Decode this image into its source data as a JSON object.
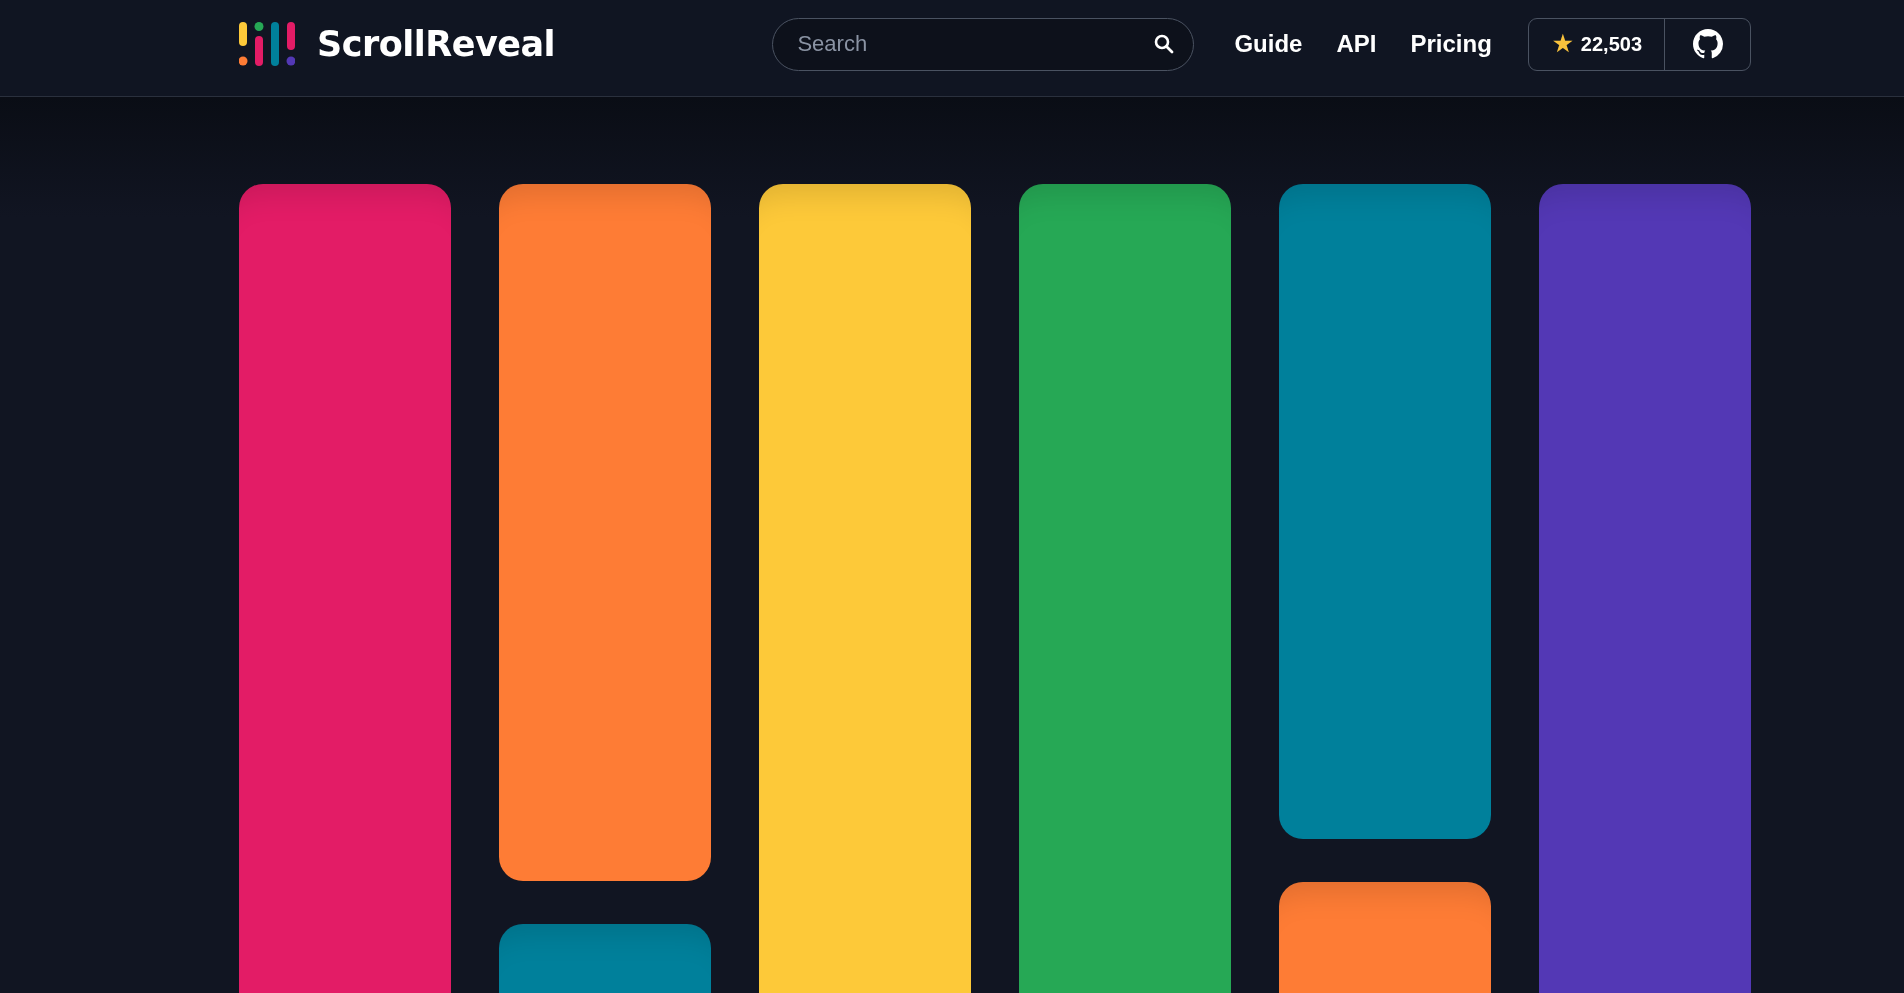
{
  "header": {
    "logo": "ScrollReveal",
    "search": {
      "placeholder": "Search"
    },
    "nav": [
      {
        "label": "Guide"
      },
      {
        "label": "API"
      },
      {
        "label": "Pricing"
      }
    ],
    "stars": {
      "icon": "★",
      "count": "22,503"
    }
  },
  "columns": [
    {
      "tiles": [
        {
          "kind": "fill",
          "color": "#e31c66"
        }
      ]
    },
    {
      "tiles": [
        {
          "kind": "long",
          "color": "#fe7c35"
        },
        {
          "kind": "fill",
          "color": "#00809b"
        }
      ]
    },
    {
      "tiles": [
        {
          "kind": "fill",
          "color": "#fdc939"
        }
      ]
    },
    {
      "tiles": [
        {
          "kind": "fill",
          "color": "#26a855"
        }
      ]
    },
    {
      "tiles": [
        {
          "kind": "medium",
          "color": "#00809b"
        },
        {
          "kind": "fill",
          "color": "#fe7c35"
        }
      ]
    },
    {
      "tiles": [
        {
          "kind": "fill",
          "color": "#5338b5"
        }
      ]
    }
  ]
}
